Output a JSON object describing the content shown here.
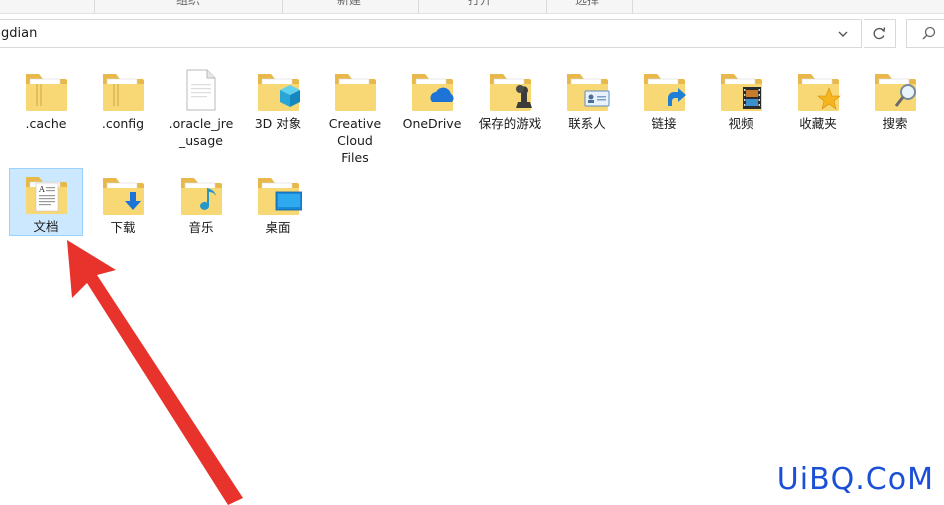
{
  "ribbon": {
    "groups": [
      "组织",
      "新建",
      "打开",
      "选择"
    ]
  },
  "address": {
    "path_text": "gdian"
  },
  "colors": {
    "folder": "#f4c95d",
    "selection": "#cce8ff",
    "arrow": "#e8322c",
    "watermark": "#1a4fd6"
  },
  "folders": [
    {
      "label": ".cache",
      "icon": "folder-docs-icon"
    },
    {
      "label": ".config",
      "icon": "folder-docs-icon"
    },
    {
      "label": ".oracle_jre\n_usage",
      "icon": "file-blank-icon"
    },
    {
      "label": "3D 对象",
      "icon": "folder-3d-objects-icon"
    },
    {
      "label": "Creative\nCloud\nFiles",
      "icon": "folder-icon"
    },
    {
      "label": "OneDrive",
      "icon": "folder-onedrive-icon"
    },
    {
      "label": "保存的游戏",
      "icon": "folder-saved-games-icon"
    },
    {
      "label": "联系人",
      "icon": "folder-contacts-icon"
    },
    {
      "label": "链接",
      "icon": "folder-links-icon"
    },
    {
      "label": "视频",
      "icon": "folder-videos-icon"
    },
    {
      "label": "收藏夹",
      "icon": "folder-favorites-icon"
    },
    {
      "label": "搜索",
      "icon": "folder-searches-icon"
    },
    {
      "label": "文档",
      "icon": "folder-documents-icon",
      "selected": true
    },
    {
      "label": "下载",
      "icon": "folder-downloads-icon"
    },
    {
      "label": "音乐",
      "icon": "folder-music-icon"
    },
    {
      "label": "桌面",
      "icon": "folder-desktop-icon"
    }
  ],
  "watermark": "UiBQ.CoM"
}
